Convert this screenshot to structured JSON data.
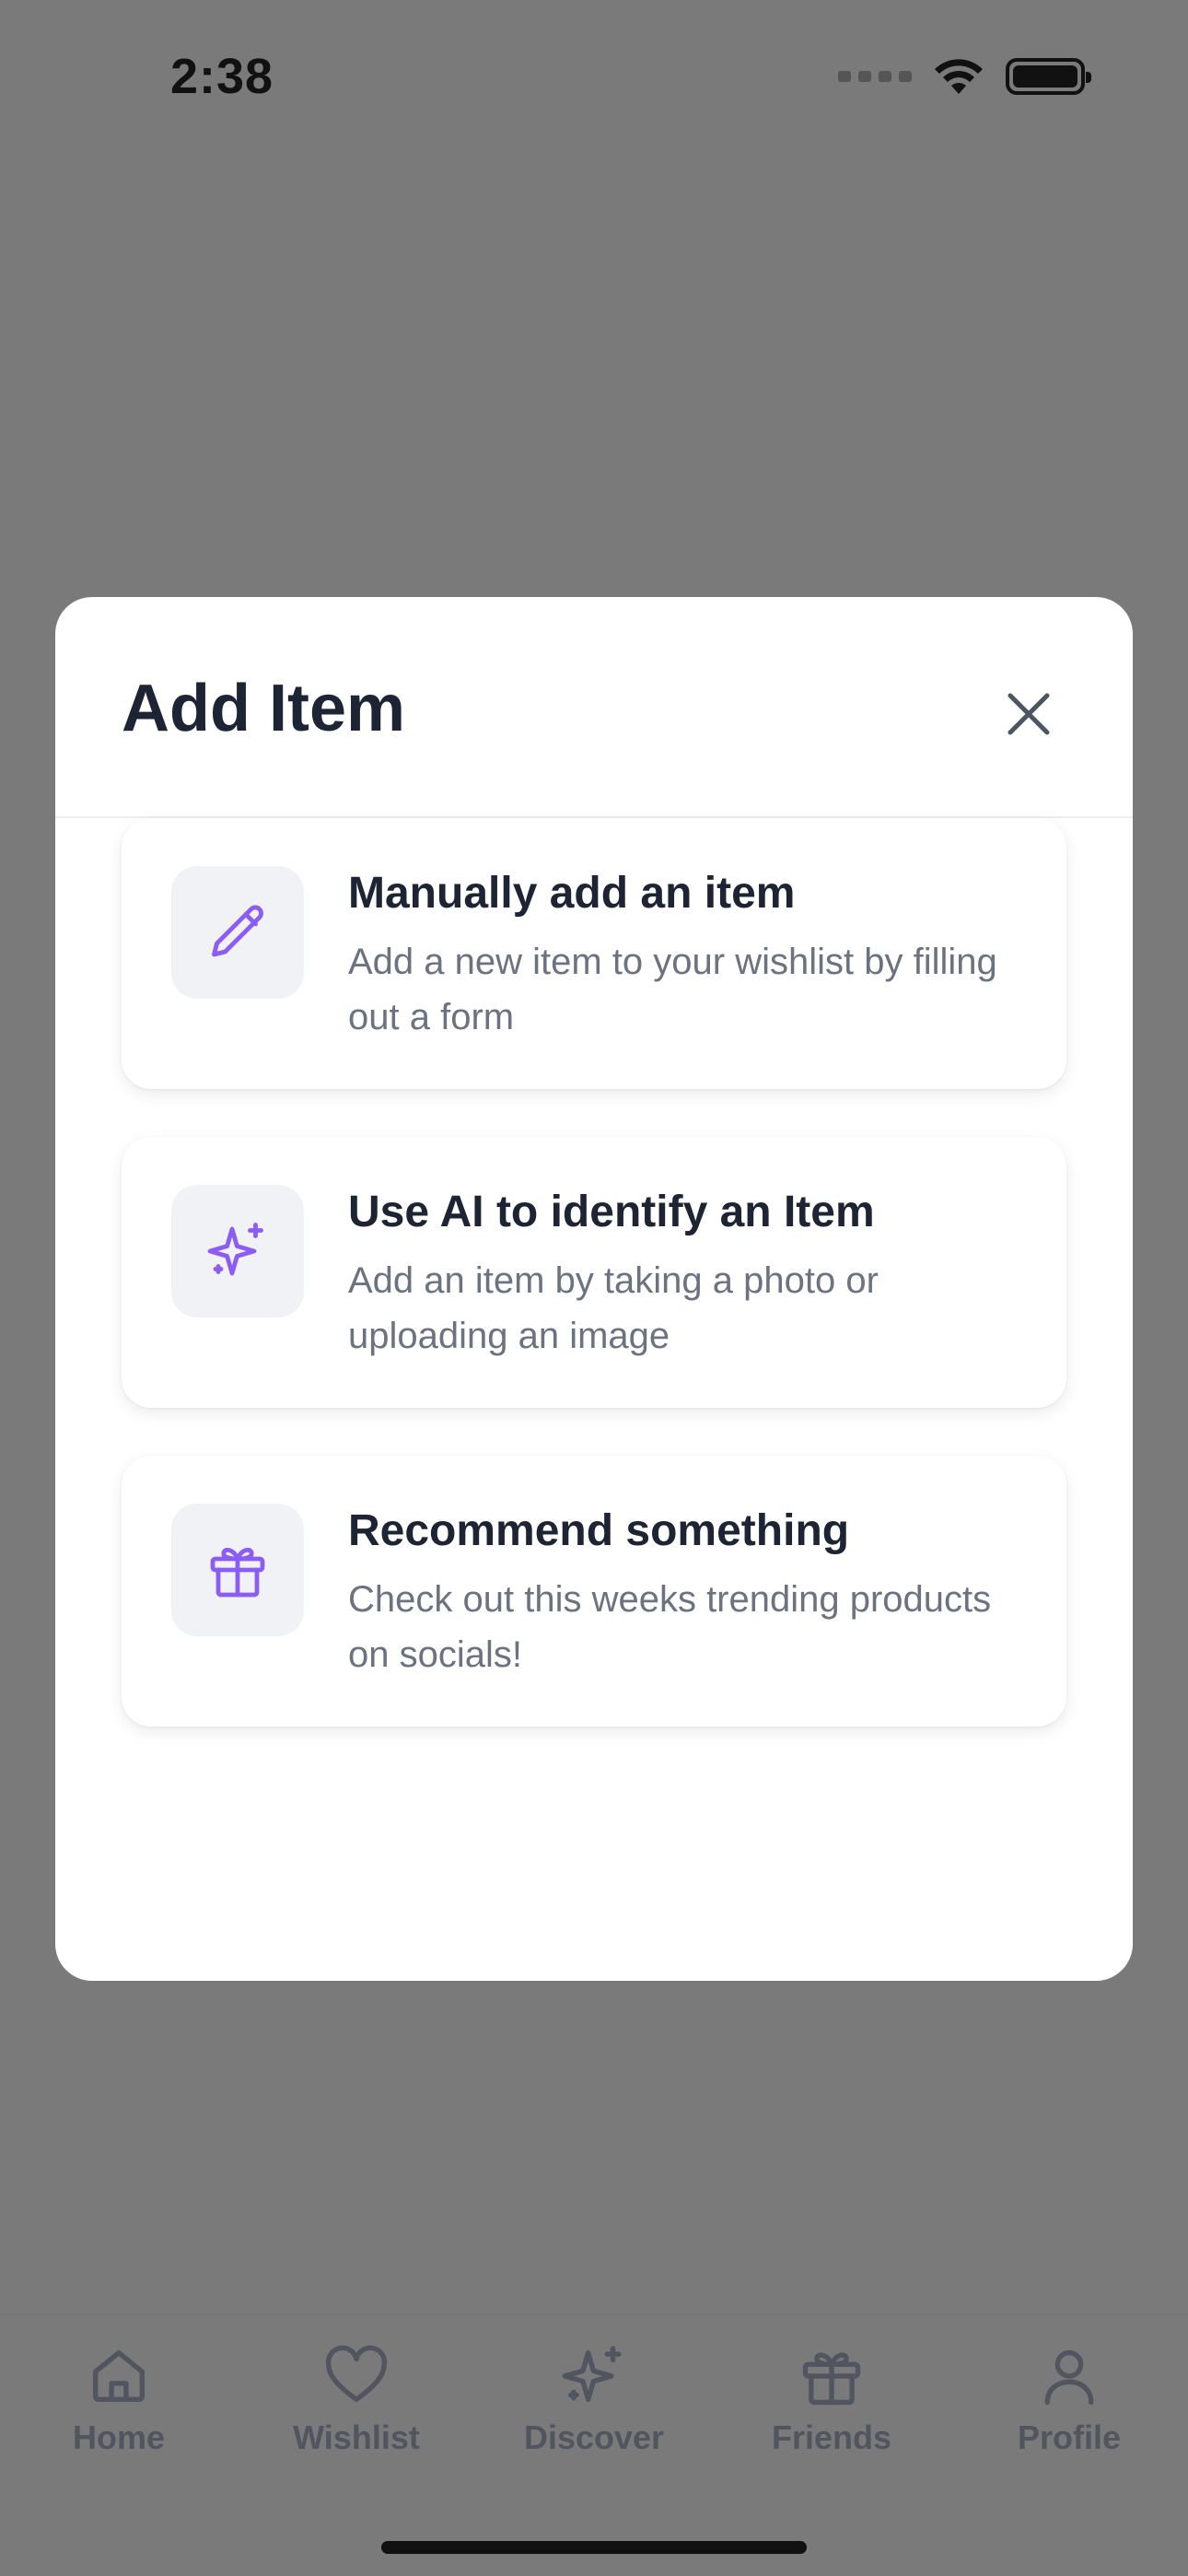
{
  "status_bar": {
    "time": "2:38"
  },
  "modal": {
    "title": "Add Item",
    "close_icon": "close-icon",
    "options": [
      {
        "icon": "pencil-icon",
        "title": "Manually add an item",
        "description": "Add a new item to your wishlist by filling out a form"
      },
      {
        "icon": "sparkles-icon",
        "title": "Use AI to identify an Item",
        "description": "Add an item by taking a photo or uploading an image"
      },
      {
        "icon": "gift-icon",
        "title": "Recommend something",
        "description": "Check out this weeks trending products on socials!"
      }
    ]
  },
  "tab_bar": {
    "items": [
      {
        "label": "Home",
        "icon": "home-icon"
      },
      {
        "label": "Wishlist",
        "icon": "heart-icon"
      },
      {
        "label": "Discover",
        "icon": "sparkles-icon"
      },
      {
        "label": "Friends",
        "icon": "gift-icon"
      },
      {
        "label": "Profile",
        "icon": "user-icon"
      }
    ]
  },
  "colors": {
    "accent": "#8b5cf6",
    "overlay": "#7a7a7a",
    "title_text": "#1d2433",
    "secondary_text": "#6b7280"
  }
}
